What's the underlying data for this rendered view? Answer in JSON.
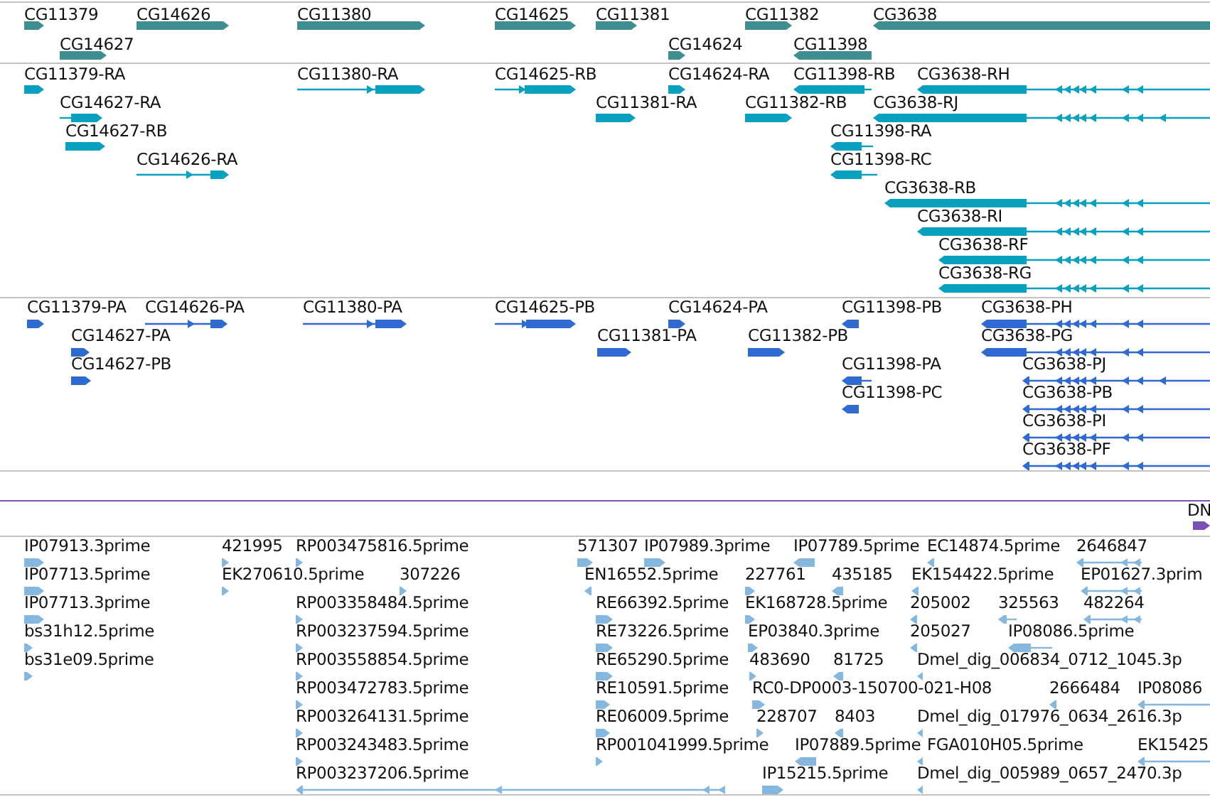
{
  "tracks": [
    {
      "kind": "genes",
      "features": [
        {
          "label": "CG11379",
          "reverse": false
        },
        {
          "label": "CG14626",
          "reverse": false
        },
        {
          "label": "CG14627",
          "reverse": false
        },
        {
          "label": "CG11380",
          "reverse": false
        },
        {
          "label": "CG14625",
          "reverse": false
        },
        {
          "label": "CG11381",
          "reverse": false
        },
        {
          "label": "CG14624",
          "reverse": false
        },
        {
          "label": "CG11382",
          "reverse": false
        },
        {
          "label": "CG11398",
          "reverse": true
        },
        {
          "label": "CG3638",
          "reverse": true
        }
      ]
    },
    {
      "kind": "transcripts",
      "features": [
        {
          "label": "CG11379-RA",
          "reverse": false
        },
        {
          "label": "CG14627-RA",
          "reverse": false
        },
        {
          "label": "CG14627-RB",
          "reverse": false
        },
        {
          "label": "CG14626-RA",
          "reverse": false
        },
        {
          "label": "CG11380-RA",
          "reverse": false
        },
        {
          "label": "CG14625-RB",
          "reverse": false
        },
        {
          "label": "CG11381-RA",
          "reverse": false
        },
        {
          "label": "CG14624-RA",
          "reverse": false
        },
        {
          "label": "CG11382-RB",
          "reverse": false
        },
        {
          "label": "CG11398-RB",
          "reverse": true
        },
        {
          "label": "CG11398-RA",
          "reverse": true
        },
        {
          "label": "CG11398-RC",
          "reverse": true
        },
        {
          "label": "CG3638-RH",
          "reverse": true
        },
        {
          "label": "CG3638-RJ",
          "reverse": true
        },
        {
          "label": "CG3638-RB",
          "reverse": true
        },
        {
          "label": "CG3638-RI",
          "reverse": true
        },
        {
          "label": "CG3638-RF",
          "reverse": true
        },
        {
          "label": "CG3638-RG",
          "reverse": true
        }
      ]
    },
    {
      "kind": "proteins",
      "features": [
        {
          "label": "CG11379-PA",
          "reverse": false
        },
        {
          "label": "CG14626-PA",
          "reverse": false
        },
        {
          "label": "CG14627-PA",
          "reverse": false
        },
        {
          "label": "CG14627-PB",
          "reverse": false
        },
        {
          "label": "CG11380-PA",
          "reverse": false
        },
        {
          "label": "CG14625-PB",
          "reverse": false
        },
        {
          "label": "CG11381-PA",
          "reverse": false
        },
        {
          "label": "CG14624-PA",
          "reverse": false
        },
        {
          "label": "CG11382-PB",
          "reverse": false
        },
        {
          "label": "CG11398-PB",
          "reverse": true
        },
        {
          "label": "CG11398-PA",
          "reverse": true
        },
        {
          "label": "CG11398-PC",
          "reverse": true
        },
        {
          "label": "CG3638-PH",
          "reverse": true
        },
        {
          "label": "CG3638-PG",
          "reverse": true
        },
        {
          "label": "CG3638-PJ",
          "reverse": true
        },
        {
          "label": "CG3638-PB",
          "reverse": true
        },
        {
          "label": "CG3638-PI",
          "reverse": true
        },
        {
          "label": "CG3638-PF",
          "reverse": true
        }
      ]
    },
    {
      "kind": "sequence",
      "features": [
        {
          "label": "DN",
          "reverse": false
        }
      ]
    },
    {
      "kind": "ests",
      "features": [
        {
          "label": "IP07913.3prime",
          "reverse": false
        },
        {
          "label": "421995",
          "reverse": false
        },
        {
          "label": "RP003475816.5prime",
          "reverse": false
        },
        {
          "label": "571307",
          "reverse": false
        },
        {
          "label": "IP07989.3prime",
          "reverse": false
        },
        {
          "label": "IP07789.5prime",
          "reverse": true
        },
        {
          "label": "EC14874.5prime",
          "reverse": true
        },
        {
          "label": "2646847",
          "reverse": true
        },
        {
          "label": "IP07713.5prime",
          "reverse": false
        },
        {
          "label": "EK270610.5prime",
          "reverse": false
        },
        {
          "label": "307226",
          "reverse": false
        },
        {
          "label": "EN16552.5prime",
          "reverse": true
        },
        {
          "label": "227761",
          "reverse": false
        },
        {
          "label": "435185",
          "reverse": true
        },
        {
          "label": "EK154422.5prime",
          "reverse": true
        },
        {
          "label": "EP01627.3prim",
          "reverse": true
        },
        {
          "label": "IP07713.3prime",
          "reverse": false
        },
        {
          "label": "RP003358484.5prime",
          "reverse": false
        },
        {
          "label": "RE66392.5prime",
          "reverse": false
        },
        {
          "label": "EK168728.5prime",
          "reverse": false
        },
        {
          "label": "205002",
          "reverse": true
        },
        {
          "label": "325563",
          "reverse": true
        },
        {
          "label": "482264",
          "reverse": true
        },
        {
          "label": "bs31h12.5prime",
          "reverse": false
        },
        {
          "label": "RP003237594.5prime",
          "reverse": false
        },
        {
          "label": "RE73226.5prime",
          "reverse": false
        },
        {
          "label": "EP03840.3prime",
          "reverse": false
        },
        {
          "label": "205027",
          "reverse": true
        },
        {
          "label": "IP08086.5prime",
          "reverse": true
        },
        {
          "label": "bs31e09.5prime",
          "reverse": false
        },
        {
          "label": "RP003558854.5prime",
          "reverse": false
        },
        {
          "label": "RE65290.5prime",
          "reverse": false
        },
        {
          "label": "483690",
          "reverse": false
        },
        {
          "label": "81725",
          "reverse": true
        },
        {
          "label": "Dmel_dig_006834_0712_1045.3p",
          "reverse": true
        },
        {
          "label": "RP003472783.5prime",
          "reverse": false
        },
        {
          "label": "RE10591.5prime",
          "reverse": false
        },
        {
          "label": "RC0-DP0003-150700-021-H08",
          "reverse": false
        },
        {
          "label": "2666484",
          "reverse": true
        },
        {
          "label": "IP08086",
          "reverse": true
        },
        {
          "label": "RP003264131.5prime",
          "reverse": false
        },
        {
          "label": "RE06009.5prime",
          "reverse": false
        },
        {
          "label": "228707",
          "reverse": false
        },
        {
          "label": "8403",
          "reverse": true
        },
        {
          "label": "Dmel_dig_017976_0634_2616.3p",
          "reverse": true
        },
        {
          "label": "RP003243483.5prime",
          "reverse": false
        },
        {
          "label": "RP001041999.5prime",
          "reverse": false
        },
        {
          "label": "IP07889.5prime",
          "reverse": true
        },
        {
          "label": "FGA010H05.5prime",
          "reverse": true
        },
        {
          "label": "EK15425",
          "reverse": true
        },
        {
          "label": "RP003237206.5prime",
          "reverse": true
        },
        {
          "label": "IP15215.5prime",
          "reverse": false
        },
        {
          "label": "Dmel_dig_005989_0657_2470.3p",
          "reverse": true
        }
      ]
    }
  ]
}
